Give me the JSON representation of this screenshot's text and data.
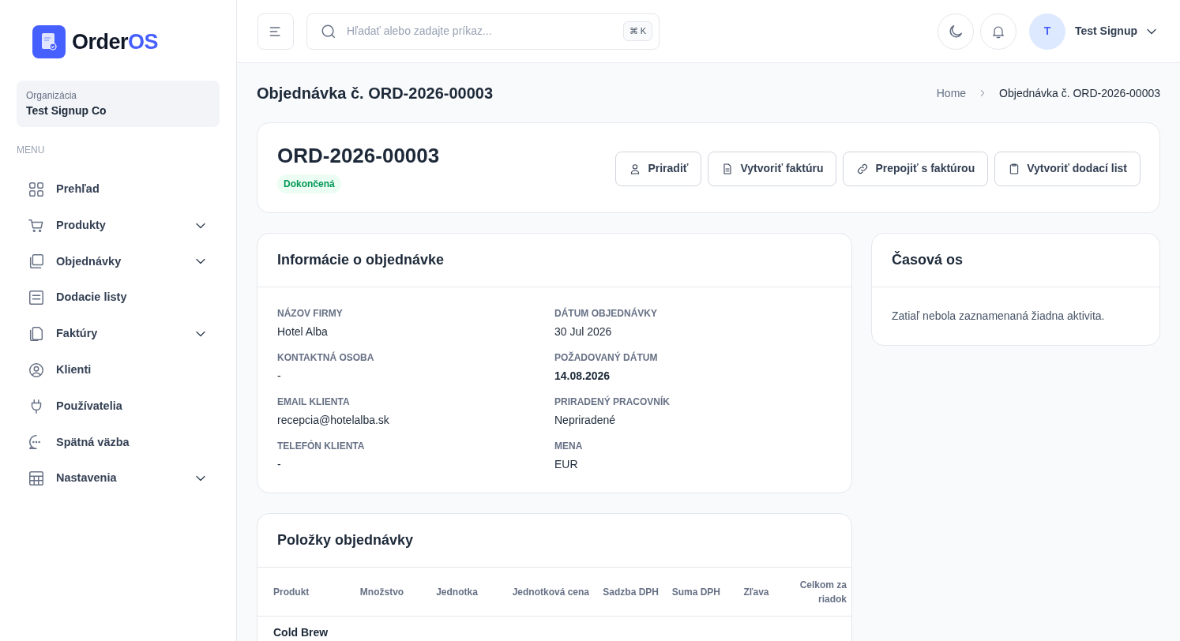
{
  "brand": {
    "name_main": "Order",
    "name_accent": "OS"
  },
  "organization": {
    "label": "Organizácia",
    "name": "Test Signup Co"
  },
  "sidebar": {
    "heading": "MENU",
    "items": [
      {
        "label": "Prehľad",
        "expandable": false
      },
      {
        "label": "Produkty",
        "expandable": true
      },
      {
        "label": "Objednávky",
        "expandable": true
      },
      {
        "label": "Dodacie listy",
        "expandable": false
      },
      {
        "label": "Faktúry",
        "expandable": true
      },
      {
        "label": "Klienti",
        "expandable": false
      },
      {
        "label": "Používatelia",
        "expandable": false
      },
      {
        "label": "Spätná väzba",
        "expandable": false
      },
      {
        "label": "Nastavenia",
        "expandable": true
      }
    ]
  },
  "header": {
    "search": {
      "placeholder": "Hľadať alebo zadajte príkaz...",
      "shortcut": "⌘ K"
    },
    "user": {
      "initial": "T",
      "name": "Test Signup"
    }
  },
  "page": {
    "title": "Objednávka č. ORD-2026-00003",
    "breadcrumb": [
      "Home",
      "Objednávka č. ORD-2026-00003"
    ]
  },
  "order": {
    "number": "ORD-2026-00003",
    "status": "Dokončená",
    "actions": [
      "Priradiť",
      "Vytvoriť faktúru",
      "Prepojiť s faktúrou",
      "Vytvoriť dodací list"
    ]
  },
  "info": {
    "title": "Informácie o objednávke",
    "fields": [
      {
        "label": "NÁZOV FIRMY",
        "value": "Hotel Alba",
        "emphasis": false
      },
      {
        "label": "DÁTUM OBJEDNÁVKY",
        "value": "30 Jul 2026",
        "emphasis": false
      },
      {
        "label": "KONTAKTNÁ OSOBA",
        "value": "-",
        "emphasis": false
      },
      {
        "label": "POŽADOVANÝ DÁTUM",
        "value": "14.08.2026",
        "emphasis": true
      },
      {
        "label": "EMAIL KLIENTA",
        "value": "recepcia@hotelalba.sk",
        "emphasis": false
      },
      {
        "label": "PRIRADENÝ PRACOVNÍK",
        "value": "Nepriradené",
        "emphasis": false
      },
      {
        "label": "TELEFÓN KLIENTA",
        "value": "-",
        "emphasis": false
      },
      {
        "label": "MENA",
        "value": "EUR",
        "emphasis": false
      }
    ]
  },
  "timeline": {
    "title": "Časová os",
    "empty": "Zatiaľ nebola zaznamenaná žiadna aktivita."
  },
  "items": {
    "title": "Položky objednávky",
    "columns": [
      "Produkt",
      "Množstvo",
      "Jednotka",
      "Jednotková cena",
      "Sadzba DPH",
      "Suma DPH",
      "Zľava",
      "Celkom za riadok"
    ],
    "rows": [
      [
        "Cold Brew"
      ]
    ]
  }
}
